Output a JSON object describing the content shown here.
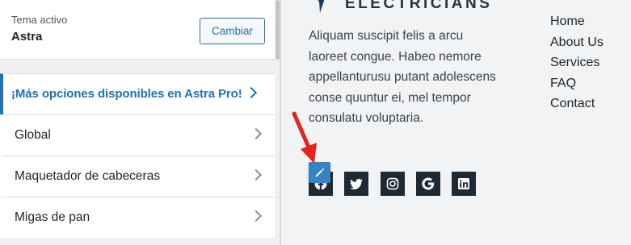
{
  "theme": {
    "label": "Tema activo",
    "name": "Astra",
    "change_button": "Cambiar"
  },
  "sections": [
    {
      "label": "¡Más opciones disponibles en Astra Pro!",
      "type": "pro"
    },
    {
      "label": "Global",
      "type": "section"
    },
    {
      "label": "Maquetador de cabeceras",
      "type": "section"
    },
    {
      "label": "Migas de pan",
      "type": "section"
    }
  ],
  "preview": {
    "logo_text": "ELECTRICIANS",
    "about_text": "Aliquam suscipit felis a arcu laoreet congue. Habeo nemore appellanturusu putant adolescens conse quuntur ei, mel tempor consulatu voluptaria.",
    "menu": [
      "Home",
      "About Us",
      "Services",
      "FAQ",
      "Contact"
    ],
    "socials": [
      "facebook-icon",
      "twitter-icon",
      "instagram-icon",
      "google-icon",
      "linkedin-icon"
    ]
  },
  "colors": {
    "accent": "#2271b1",
    "edit_button": "#3582c4",
    "social_bg": "#1e2a33",
    "arrow": "#e8231b"
  }
}
